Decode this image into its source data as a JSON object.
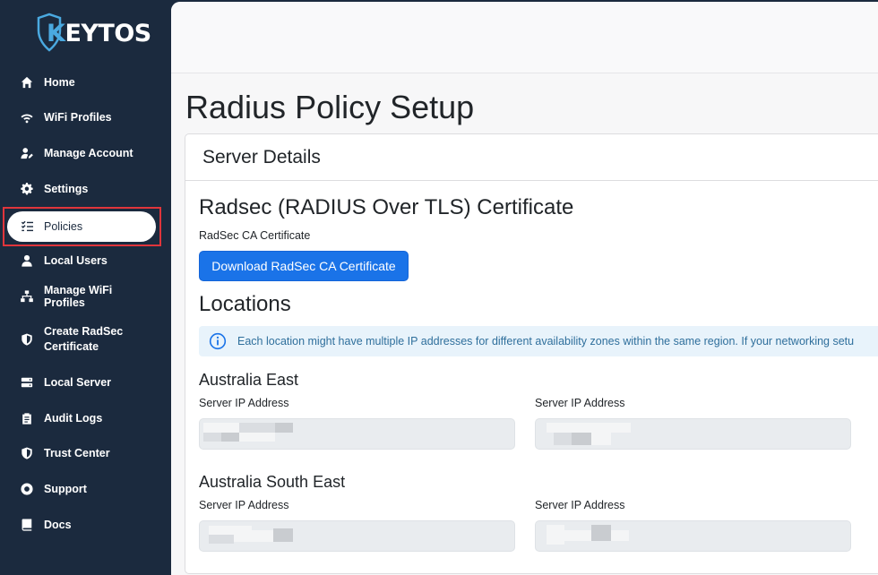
{
  "brand": {
    "logo_text_k": "K",
    "logo_text_rest": "EYTOS",
    "accent": "#4aa9e0"
  },
  "sidebar": {
    "items": [
      {
        "label": "Home",
        "icon": "home-icon"
      },
      {
        "label": "WiFi Profiles",
        "icon": "wifi-icon"
      },
      {
        "label": "Manage Account",
        "icon": "user-edit-icon"
      },
      {
        "label": "Settings",
        "icon": "gear-icon"
      },
      {
        "label": "Policies",
        "icon": "list-check-icon",
        "active": true
      },
      {
        "label": "Local Users",
        "icon": "user-icon"
      },
      {
        "label": "Manage WiFi Profiles",
        "icon": "network-icon"
      },
      {
        "label": "Create RadSec Certificate",
        "icon": "shield-icon"
      },
      {
        "label": "Local Server",
        "icon": "server-icon"
      },
      {
        "label": "Audit Logs",
        "icon": "clipboard-icon"
      },
      {
        "label": "Trust Center",
        "icon": "shield-icon"
      },
      {
        "label": "Support",
        "icon": "life-ring-icon"
      },
      {
        "label": "Docs",
        "icon": "book-icon"
      }
    ]
  },
  "main": {
    "page_title": "Radius Policy Setup",
    "card_header": "Server Details",
    "cert_section_title": "Radsec (RADIUS Over TLS) Certificate",
    "cert_label": "RadSec CA Certificate",
    "download_button": "Download RadSec CA Certificate",
    "locations_title": "Locations",
    "info_text": "Each location might have multiple IP addresses for different availability zones within the same region. If your networking setu",
    "regions": [
      {
        "name": "Australia East",
        "fields": [
          {
            "label": "Server IP Address"
          },
          {
            "label": "Server IP Address"
          }
        ]
      },
      {
        "name": "Australia South East",
        "fields": [
          {
            "label": "Server IP Address"
          },
          {
            "label": "Server IP Address"
          }
        ]
      }
    ]
  },
  "colors": {
    "sidebar_bg": "#1b2a3e",
    "primary": "#1a73e8",
    "highlight": "#e0353b"
  }
}
